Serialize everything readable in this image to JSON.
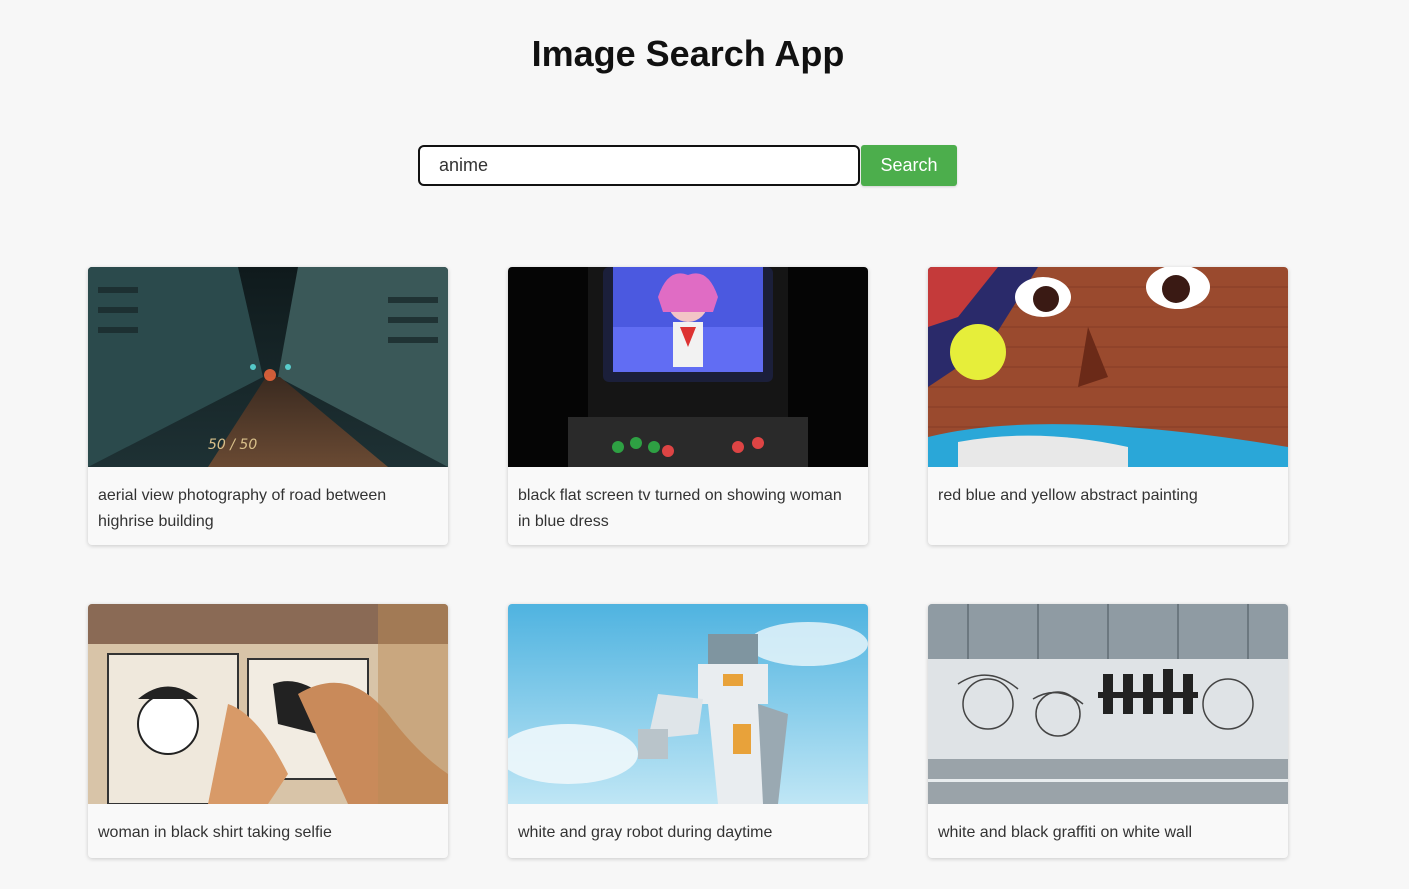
{
  "header": {
    "title": "Image Search App"
  },
  "search": {
    "value": "anime",
    "placeholder": "",
    "button_label": "Search"
  },
  "results": [
    {
      "caption": "aerial view photography of road between highrise building",
      "image": "night-street-photo"
    },
    {
      "caption": "black flat screen tv turned on showing woman in blue dress",
      "image": "arcade-screen-photo"
    },
    {
      "caption": "red blue and yellow abstract painting",
      "image": "graffiti-face-photo"
    },
    {
      "caption": "woman in black shirt taking selfie",
      "image": "manga-wall-photo"
    },
    {
      "caption": "white and gray robot during daytime",
      "image": "robot-statue-photo"
    },
    {
      "caption": "white and black graffiti on white wall",
      "image": "manga-mural-photo"
    }
  ],
  "colors": {
    "background": "#f7f7f7",
    "accent": "#4cae4c",
    "input_border": "#111111"
  }
}
